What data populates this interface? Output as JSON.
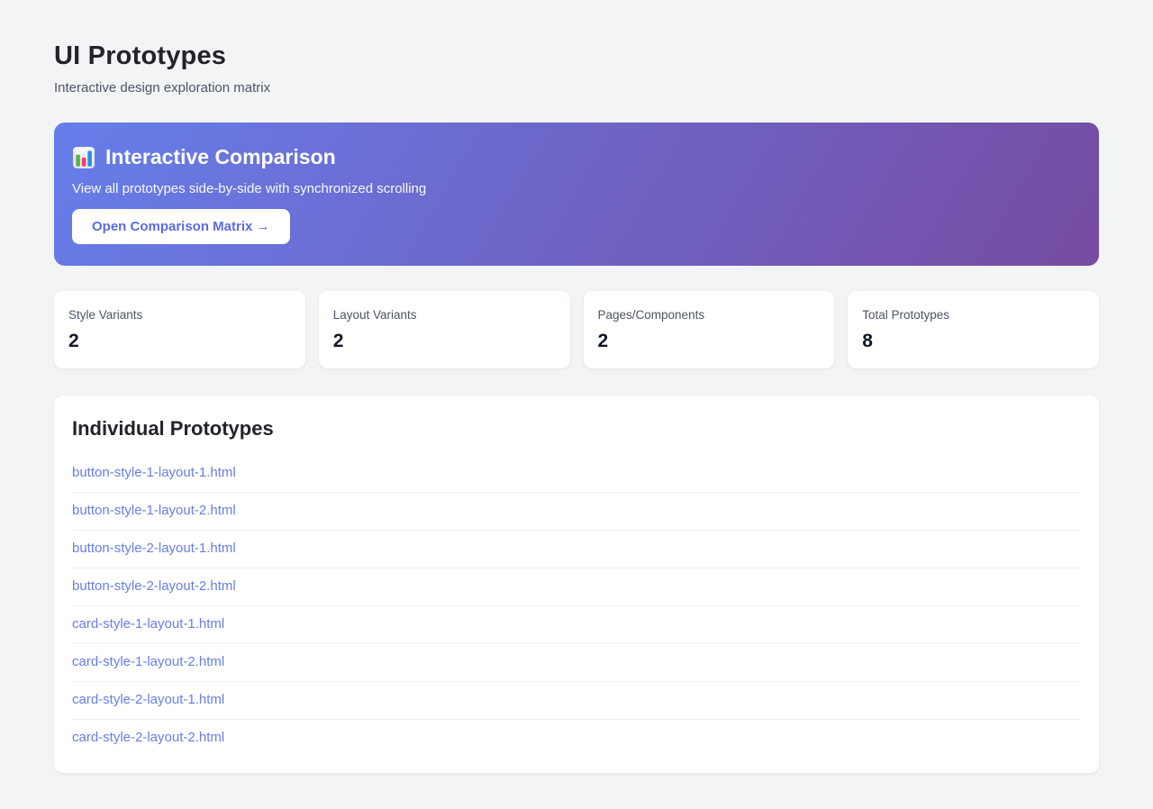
{
  "page": {
    "title": "UI Prototypes",
    "subtitle": "Interactive design exploration matrix"
  },
  "banner": {
    "icon": "bar-chart-emoji",
    "title": "Interactive Comparison",
    "description": "View all prototypes side-by-side with synchronized scrolling",
    "button_label": "Open Comparison Matrix →",
    "gradient_start": "#667eea",
    "gradient_end": "#764ba2",
    "button_text_color": "#5b6be0"
  },
  "stats": [
    {
      "label": "Style Variants",
      "value": "2"
    },
    {
      "label": "Layout Variants",
      "value": "2"
    },
    {
      "label": "Pages/Components",
      "value": "2"
    },
    {
      "label": "Total Prototypes",
      "value": "8"
    }
  ],
  "prototypes": {
    "heading": "Individual Prototypes",
    "links": [
      "button-style-1-layout-1.html",
      "button-style-1-layout-2.html",
      "button-style-2-layout-1.html",
      "button-style-2-layout-2.html",
      "card-style-1-layout-1.html",
      "card-style-1-layout-2.html",
      "card-style-2-layout-1.html",
      "card-style-2-layout-2.html"
    ]
  },
  "colors": {
    "background": "#f3f4f5",
    "card": "#ffffff",
    "link": "#667eea",
    "heading_text": "#212529",
    "muted_text": "#4b5563"
  }
}
